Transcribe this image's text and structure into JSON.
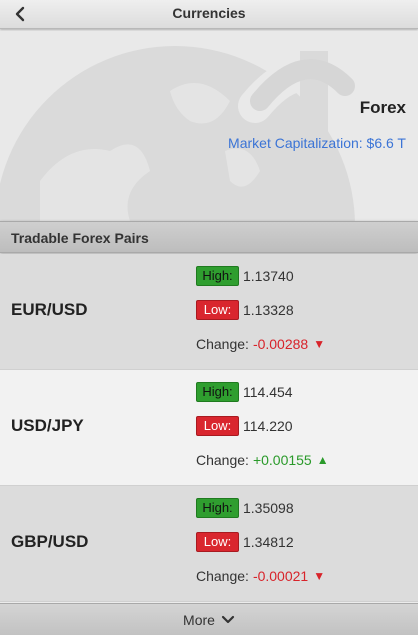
{
  "header": {
    "title": "Currencies",
    "back_icon": "chevron-left-icon"
  },
  "hero": {
    "title": "Forex",
    "market_cap": "Market Capitalization: $6.6 T",
    "background_icon": "globe-dollar-icon"
  },
  "section": {
    "title": "Tradable Forex Pairs"
  },
  "labels": {
    "high": "High:",
    "low": "Low:",
    "change": "Change:"
  },
  "colors": {
    "accent": "#3b74d6",
    "high_badge": "#2f9e2f",
    "low_badge": "#d9262e",
    "negative": "#d8232a",
    "positive": "#2a9a2a"
  },
  "pairs": [
    {
      "name": "EUR/USD",
      "high": "1.13740",
      "low": "1.13328",
      "change": "-0.00288",
      "direction": "down"
    },
    {
      "name": "USD/JPY",
      "high": "114.454",
      "low": "114.220",
      "change": "+0.00155",
      "direction": "up"
    },
    {
      "name": "GBP/USD",
      "high": "1.35098",
      "low": "1.34812",
      "change": "-0.00021",
      "direction": "down"
    }
  ],
  "footer": {
    "more_label": "More",
    "more_icon": "chevron-down-icon"
  }
}
